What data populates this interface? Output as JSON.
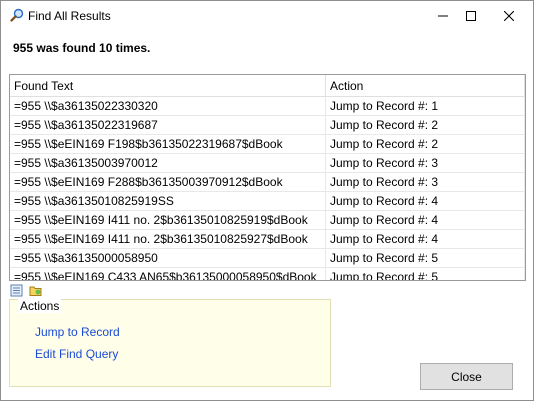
{
  "window": {
    "title": "Find All Results"
  },
  "headline": "955 was found 10 times.",
  "table": {
    "columns": [
      "Found Text",
      "Action"
    ],
    "rows": [
      {
        "found": "=955  \\\\$a36135022330320",
        "action": "Jump to Record #: 1"
      },
      {
        "found": "=955  \\\\$a36135022319687",
        "action": "Jump to Record #: 2"
      },
      {
        "found": "=955  \\\\$eEIN169 F198$b36135022319687$dBook",
        "action": "Jump to Record #: 2"
      },
      {
        "found": "=955  \\\\$a36135003970012",
        "action": "Jump to Record #: 3"
      },
      {
        "found": "=955  \\\\$eEIN169 F288$b36135003970912$dBook",
        "action": "Jump to Record #: 3"
      },
      {
        "found": "=955  \\\\$a36135010825919SS",
        "action": "Jump to Record #: 4"
      },
      {
        "found": "=955  \\\\$eEIN169 I411 no. 2$b36135010825919$dBook",
        "action": "Jump to Record #: 4"
      },
      {
        "found": "=955  \\\\$eEIN169 I411 no. 2$b36135010825927$dBook",
        "action": "Jump to Record #: 4"
      },
      {
        "found": "=955  \\\\$a36135000058950",
        "action": "Jump to Record #: 5"
      },
      {
        "found": "=955  \\\\$eEIN169 C433 AN65$b36135000058950$dBook",
        "action": "Jump to Record #: 5"
      }
    ]
  },
  "actions": {
    "title": "Actions",
    "items": [
      "Jump to Record",
      "Edit Find Query"
    ]
  },
  "buttons": {
    "close": "Close"
  },
  "colors": {
    "link": "#1a4bd6",
    "actions_panel_bg": "#fffee8",
    "close_button_bg": "#e1e1e1"
  }
}
